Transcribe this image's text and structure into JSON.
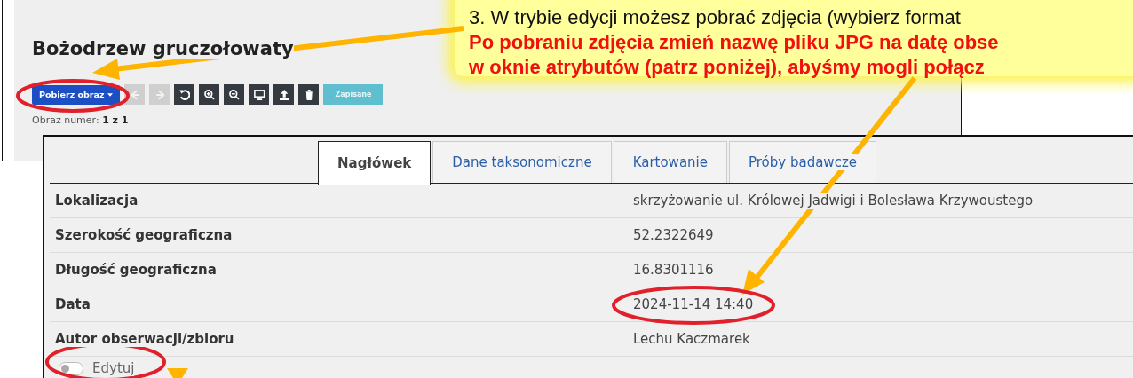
{
  "top_panel": {
    "title": "Bożodrzew gruczołowaty",
    "download_button": "Pobierz obraz",
    "toolbar_buttons": [
      {
        "kind": "prev",
        "disabled": true
      },
      {
        "kind": "next",
        "disabled": true
      },
      {
        "kind": "rotate",
        "disabled": false
      },
      {
        "kind": "zoom-in",
        "disabled": false
      },
      {
        "kind": "zoom-out",
        "disabled": false
      },
      {
        "kind": "display",
        "disabled": false
      },
      {
        "kind": "upload",
        "disabled": false
      },
      {
        "kind": "delete",
        "disabled": false
      }
    ],
    "save_button": "Zapisane",
    "image_counter": "Obraz numer: **1 z 1**"
  },
  "callout": {
    "lines": [
      {
        "kind": "instruction",
        "text": "3. W trybie edycji możesz pobrać zdjęcia (wybierz format"
      },
      {
        "kind": "warning",
        "text": "Po pobraniu zdjęcia zmień nazwę pliku JPG na datę obse"
      },
      {
        "kind": "warning",
        "text": "w oknie atrybutów (patrz poniżej), abyśmy mogli połącz"
      }
    ]
  },
  "detail_panel": {
    "tabs": [
      {
        "label": "Nagłówek",
        "selected": true
      },
      {
        "label": "Dane taksonomiczne",
        "selected": false
      },
      {
        "label": "Kartowanie",
        "selected": false
      },
      {
        "label": "Próby badawcze",
        "selected": false
      }
    ],
    "rows": [
      {
        "label": "Lokalizacja",
        "value": "skrzyżowanie ul. Królowej Jadwigi i Bolesława Krzywoustego"
      },
      {
        "label": "Szerokość geograficzna",
        "value": "52.2322649"
      },
      {
        "label": "Długość geograficzna",
        "value": "16.8301116"
      },
      {
        "label": "Data",
        "value": "2024-11-14 14:40"
      },
      {
        "label": "Autor obserwacji/zbioru",
        "value": "Lechu Kaczmarek"
      }
    ],
    "edit_toggle": {
      "label": "Edytuj",
      "on": false
    }
  }
}
